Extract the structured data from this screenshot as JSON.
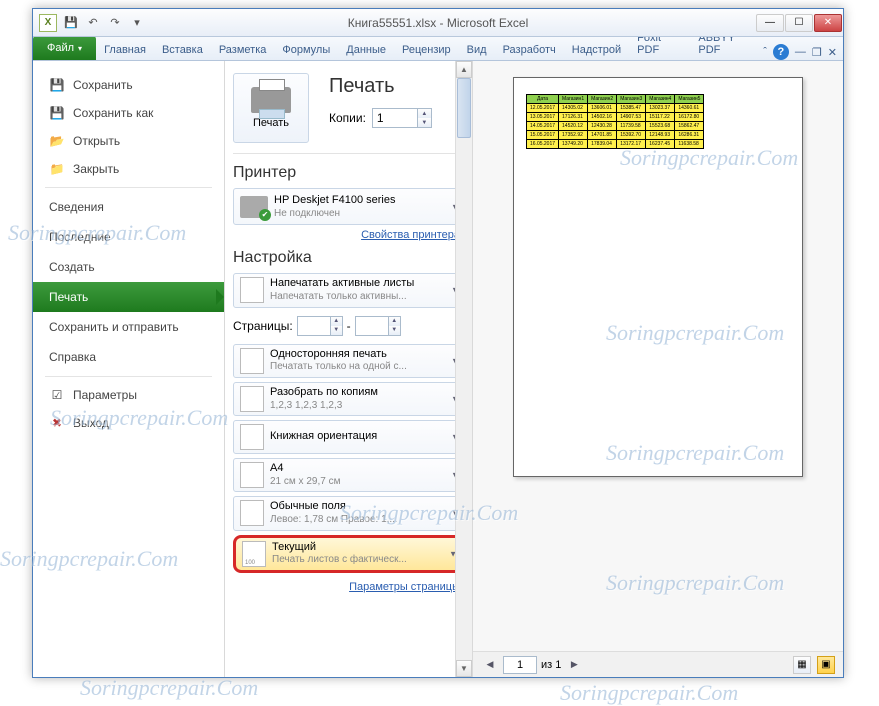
{
  "watermark": "Soringpcrepair.Com",
  "titlebar": {
    "title": "Книга55551.xlsx - Microsoft Excel"
  },
  "ribbon": {
    "file": "Файл",
    "tabs": [
      "Главная",
      "Вставка",
      "Разметка",
      "Формулы",
      "Данные",
      "Рецензир",
      "Вид",
      "Разработч",
      "Надстрой",
      "Foxit PDF",
      "ABBYY PDF"
    ]
  },
  "leftnav": {
    "save": "Сохранить",
    "saveas": "Сохранить как",
    "open": "Открыть",
    "close_doc": "Закрыть",
    "info": "Сведения",
    "recent": "Последние",
    "new": "Создать",
    "print": "Печать",
    "sendshare": "Сохранить и отправить",
    "help": "Справка",
    "options": "Параметры",
    "exit": "Выход"
  },
  "print_panel": {
    "big_button": "Печать",
    "title": "Печать",
    "copies_label": "Копии:",
    "copies_value": "1",
    "printer_label": "Принтер",
    "printer_name": "HP Deskjet F4100 series",
    "printer_status": "Не подключен",
    "printer_props": "Свойства принтера",
    "settings_label": "Настройка",
    "opt_print_active": {
      "title": "Напечатать активные листы",
      "sub": "Напечатать только активны..."
    },
    "pages_label": "Страницы:",
    "pages_dash": "-",
    "opt_oneside": {
      "title": "Односторонняя печать",
      "sub": "Печатать только на одной с..."
    },
    "opt_collate": {
      "title": "Разобрать по копиям",
      "sub": "1,2,3   1,2,3   1,2,3"
    },
    "opt_orientation": {
      "title": "Книжная ориентация",
      "sub": ""
    },
    "opt_size": {
      "title": "A4",
      "sub": "21 см x 29,7 см"
    },
    "opt_margins": {
      "title": "Обычные поля",
      "sub": "Левое: 1,78 см   Правое: 1,..."
    },
    "opt_scale": {
      "title": "Текущий",
      "sub": "Печать листов с фактическ..."
    },
    "page_setup": "Параметры страницы"
  },
  "preview_bar": {
    "page_current": "1",
    "page_of": "из 1"
  },
  "mini_table": {
    "headers": [
      "Дата",
      "Магазин1",
      "Магазин2",
      "Магазин3",
      "Магазин4",
      "Магазин5"
    ],
    "rows": [
      [
        "12.05.2017",
        "14305.02",
        "13606.01",
        "15385.47",
        "13023.37",
        "14360.61"
      ],
      [
        "13.05.2017",
        "17126.31",
        "14502.16",
        "14907.53",
        "15117.22",
        "16172.80"
      ],
      [
        "14.05.2017",
        "14520.12",
        "12430.28",
        "11739.58",
        "15523.68",
        "15862.47"
      ],
      [
        "15.05.2017",
        "17352.92",
        "14701.85",
        "15392.70",
        "12148.93",
        "16286.31"
      ],
      [
        "16.05.2017",
        "13749.20",
        "17839.04",
        "13172.17",
        "16237.45",
        "11638.58"
      ]
    ]
  }
}
